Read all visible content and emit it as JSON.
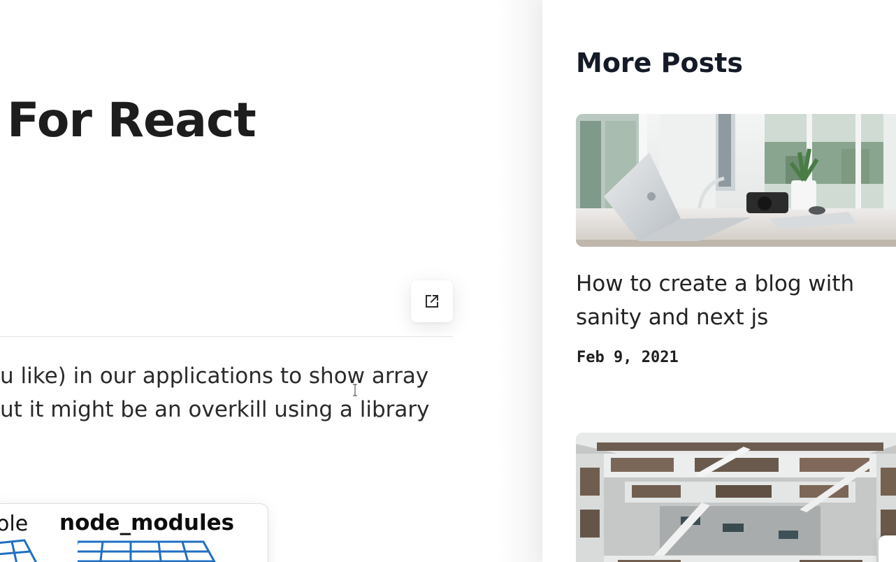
{
  "article": {
    "title": "For React",
    "body_lines": [
      "u like) in our applications to show array",
      "ut it might be an overkill using a library"
    ],
    "share_icon": "external-link-icon",
    "meme": {
      "left_label": "ole",
      "right_label": "node_modules"
    }
  },
  "sidebar": {
    "heading": "More Posts",
    "posts": [
      {
        "title": "How to create a blog with sanity and next js",
        "date": "Feb 9, 2021",
        "thumbnail": "laptop-desk-photo"
      },
      {
        "title": "",
        "date": "",
        "thumbnail": "library-atrium-photo"
      }
    ]
  },
  "colors": {
    "heading": "#141a26",
    "text": "#2a2a2a",
    "meme_grid": "#1f6fc2",
    "divider": "#e4e4e4"
  }
}
